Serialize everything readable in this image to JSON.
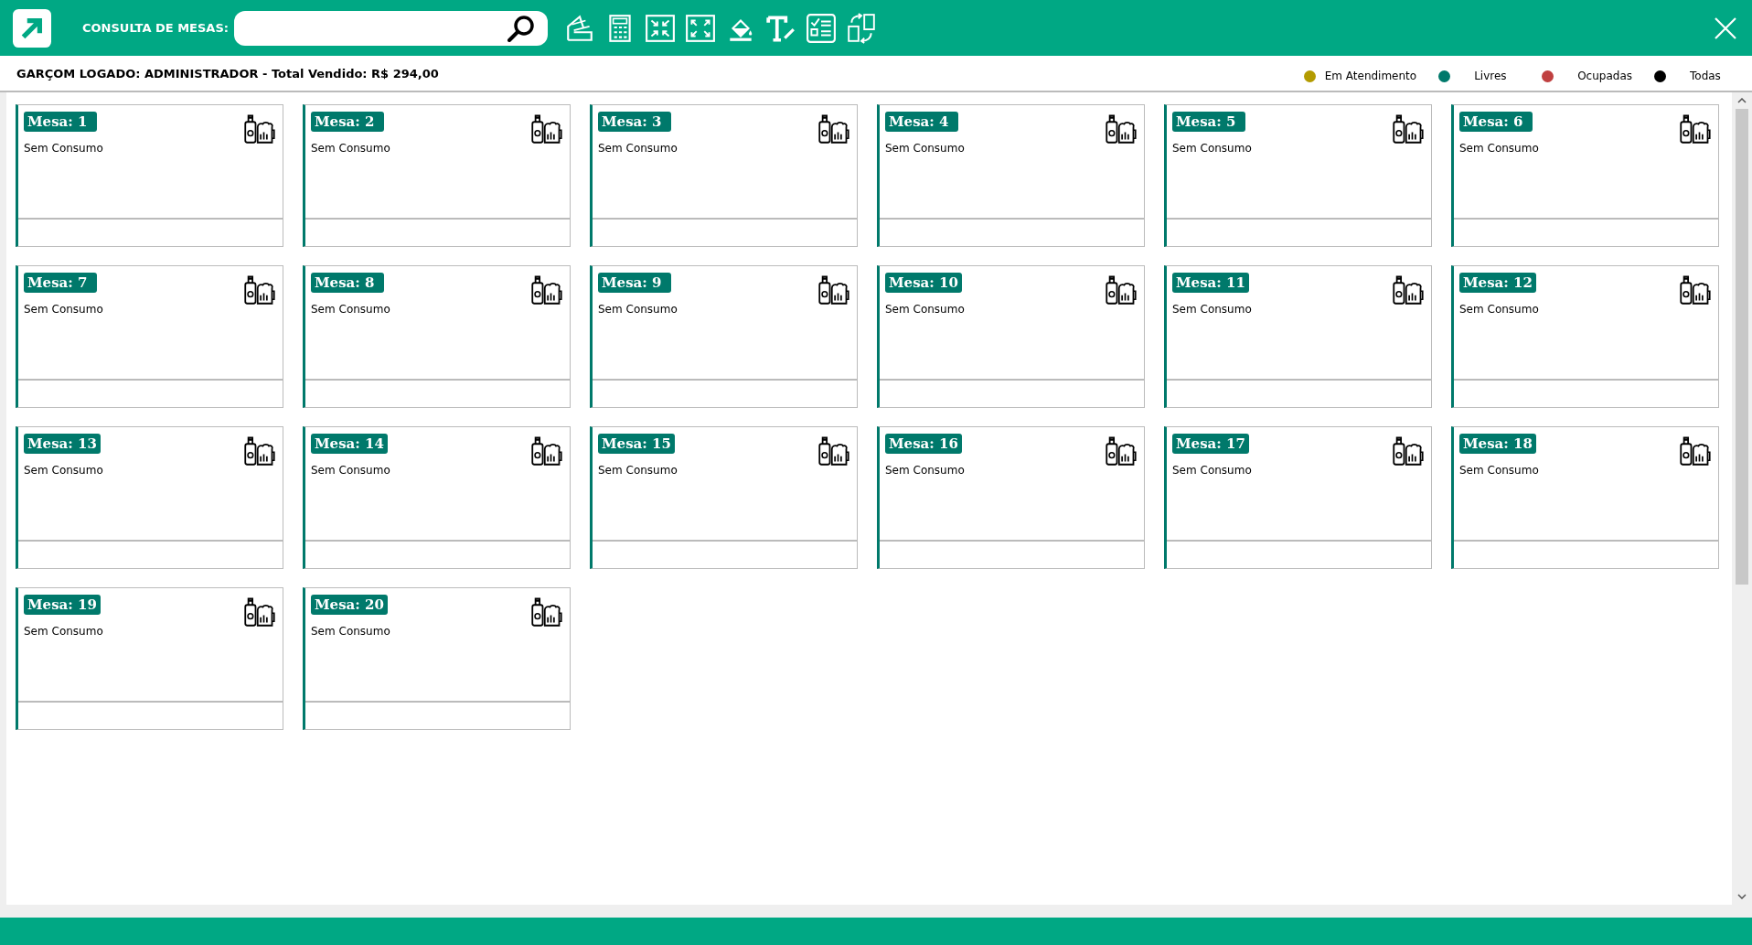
{
  "header": {
    "search_label": "CONSULTA DE MESAS:"
  },
  "info": {
    "waiter_text": "GARÇOM LOGADO: ADMINISTRADOR - Total Vendido: R$ 294,00",
    "legend": [
      {
        "label": "Em Atendimento",
        "color": "#b39b00"
      },
      {
        "label": "Livres",
        "color": "#00796b"
      },
      {
        "label": "Ocupadas",
        "color": "#c04040"
      },
      {
        "label": "Todas",
        "color": "#000000"
      }
    ]
  },
  "tables": [
    {
      "title": "Mesa: 1",
      "status": "Sem Consumo",
      "color": "#00796b"
    },
    {
      "title": "Mesa: 2",
      "status": "Sem Consumo",
      "color": "#00796b"
    },
    {
      "title": "Mesa: 3",
      "status": "Sem Consumo",
      "color": "#00796b"
    },
    {
      "title": "Mesa: 4",
      "status": "Sem Consumo",
      "color": "#00796b"
    },
    {
      "title": "Mesa: 5",
      "status": "Sem Consumo",
      "color": "#00796b"
    },
    {
      "title": "Mesa: 6",
      "status": "Sem Consumo",
      "color": "#00796b"
    },
    {
      "title": "Mesa: 7",
      "status": "Sem Consumo",
      "color": "#00796b"
    },
    {
      "title": "Mesa: 8",
      "status": "Sem Consumo",
      "color": "#00796b"
    },
    {
      "title": "Mesa: 9",
      "status": "Sem Consumo",
      "color": "#00796b"
    },
    {
      "title": "Mesa: 10",
      "status": "Sem Consumo",
      "color": "#00796b"
    },
    {
      "title": "Mesa: 11",
      "status": "Sem Consumo",
      "color": "#00796b"
    },
    {
      "title": "Mesa: 12",
      "status": "Sem Consumo",
      "color": "#00796b"
    },
    {
      "title": "Mesa: 13",
      "status": "Sem Consumo",
      "color": "#00796b"
    },
    {
      "title": "Mesa: 14",
      "status": "Sem Consumo",
      "color": "#00796b"
    },
    {
      "title": "Mesa: 15",
      "status": "Sem Consumo",
      "color": "#00796b"
    },
    {
      "title": "Mesa: 16",
      "status": "Sem Consumo",
      "color": "#00796b"
    },
    {
      "title": "Mesa: 17",
      "status": "Sem Consumo",
      "color": "#00796b"
    },
    {
      "title": "Mesa: 18",
      "status": "Sem Consumo",
      "color": "#00796b"
    },
    {
      "title": "Mesa: 19",
      "status": "Sem Consumo",
      "color": "#00796b"
    },
    {
      "title": "Mesa: 20",
      "status": "Sem Consumo",
      "color": "#00796b"
    }
  ]
}
